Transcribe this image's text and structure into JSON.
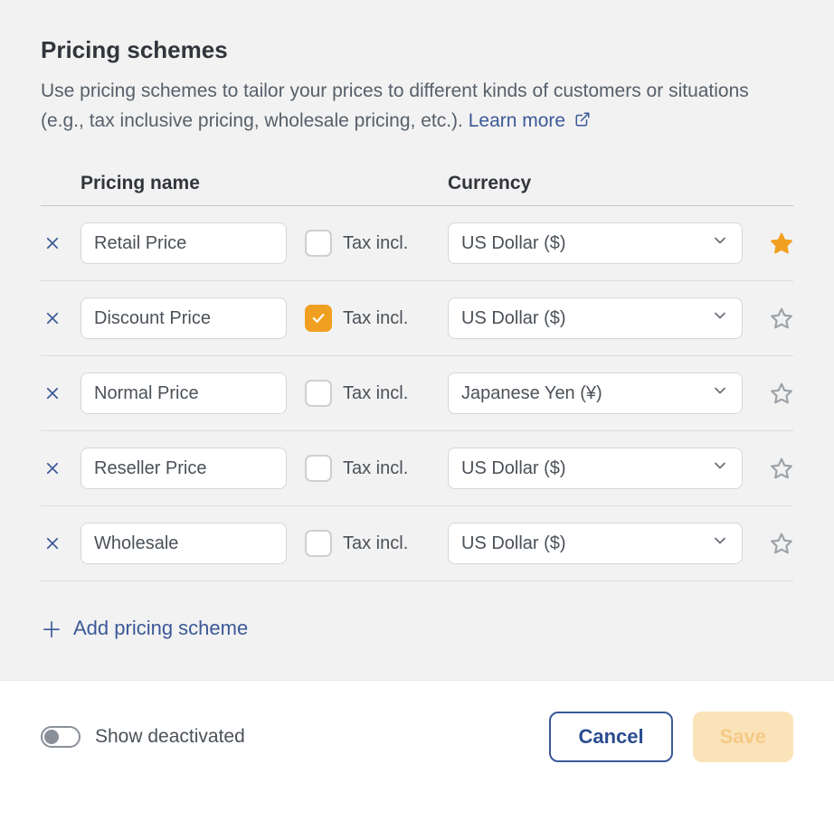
{
  "header": {
    "title": "Pricing schemes",
    "description": "Use pricing schemes to tailor your prices to different kinds of customers or situations (e.g., tax inclusive pricing, wholesale pricing, etc.).",
    "learn_more": "Learn more"
  },
  "columns": {
    "name": "Pricing name",
    "currency": "Currency"
  },
  "tax_label": "Tax incl.",
  "rows": [
    {
      "name": "Retail Price",
      "tax_incl": false,
      "currency": "US Dollar ($)",
      "favorite": true
    },
    {
      "name": "Discount Price",
      "tax_incl": true,
      "currency": "US Dollar ($)",
      "favorite": false
    },
    {
      "name": "Normal Price",
      "tax_incl": false,
      "currency": "Japanese Yen (¥)",
      "favorite": false
    },
    {
      "name": "Reseller Price",
      "tax_incl": false,
      "currency": "US Dollar ($)",
      "favorite": false
    },
    {
      "name": "Wholesale",
      "tax_incl": false,
      "currency": "US Dollar ($)",
      "favorite": false
    }
  ],
  "add_label": "Add pricing scheme",
  "footer": {
    "toggle_label": "Show deactivated",
    "toggle_on": false,
    "cancel": "Cancel",
    "save": "Save"
  }
}
